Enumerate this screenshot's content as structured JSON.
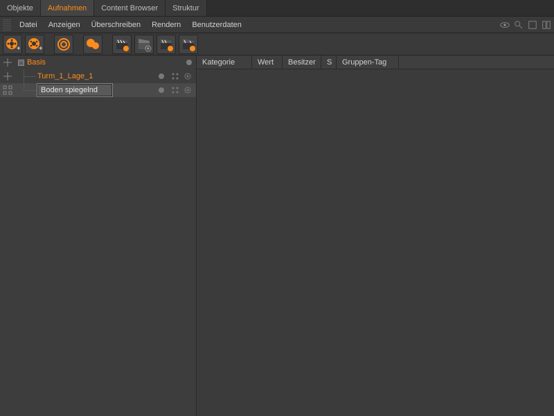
{
  "tabs": [
    {
      "label": "Objekte",
      "active": false
    },
    {
      "label": "Aufnahmen",
      "active": true
    },
    {
      "label": "Content Browser",
      "active": false
    },
    {
      "label": "Struktur",
      "active": false
    }
  ],
  "menu": {
    "items": [
      "Datei",
      "Anzeigen",
      "Überschreiben",
      "Rendern",
      "Benutzerdaten"
    ]
  },
  "toolbar_icons": [
    "reel-add-icon",
    "reel-add2-icon",
    "concentric-icon",
    "blob-icon",
    "clap1-icon",
    "clap-gear-icon",
    "clap2-icon",
    "clap3-icon"
  ],
  "tree": {
    "root": {
      "label": "Basis",
      "children": [
        {
          "label": "Turm_1_Lage_1"
        },
        {
          "label": "Boden spiegelnd",
          "editing": true
        }
      ]
    }
  },
  "columns": [
    "Kategorie",
    "Wert",
    "Besitzer",
    "S",
    "Gruppen-Tag"
  ]
}
